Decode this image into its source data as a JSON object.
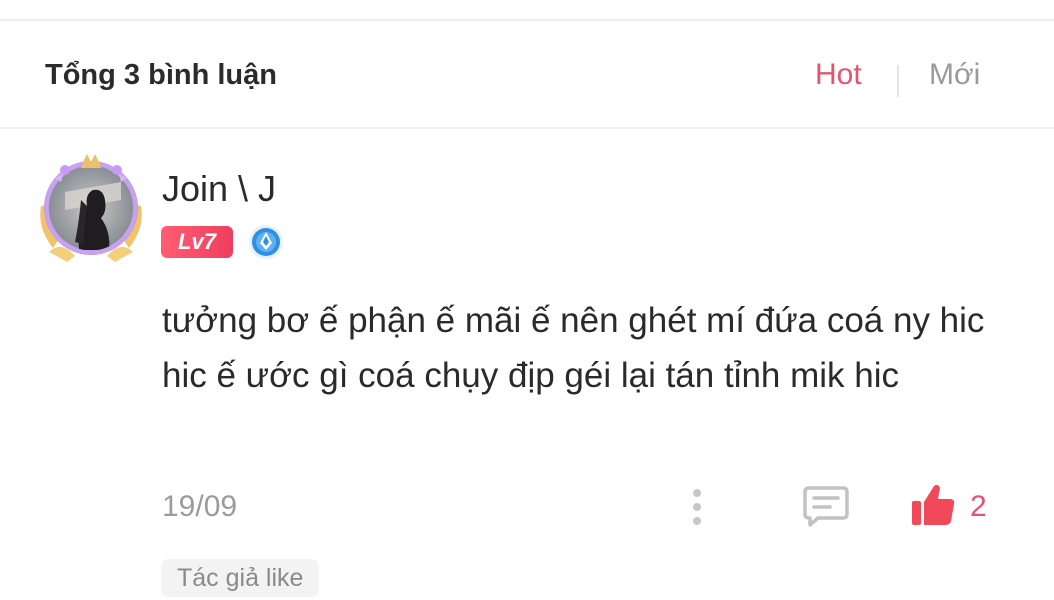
{
  "header": {
    "title": "Tổng 3 bình luận",
    "sort_hot": "Hot",
    "sort_new": "Mới",
    "active_sort": "Hot"
  },
  "comment": {
    "author": "Join \\ J",
    "level": "Lv7",
    "text": "tưởng bơ ế phận ế mãi ế nên ghét mí đứa coá ny hic hic ế ước gì coá chụy địp géi lại tán tỉnh mik hic",
    "date": "19/09",
    "likes": "2",
    "author_liked": "Tác giả like",
    "avatar_icon": "avatar-with-crown-frame",
    "medal_icon": "blue-medal-icon"
  },
  "colors": {
    "accent": "#e5546f",
    "text": "#2a2a2a",
    "muted": "#9b9b9b",
    "badge": "#f04a64",
    "medal": "#2f8fe0"
  }
}
